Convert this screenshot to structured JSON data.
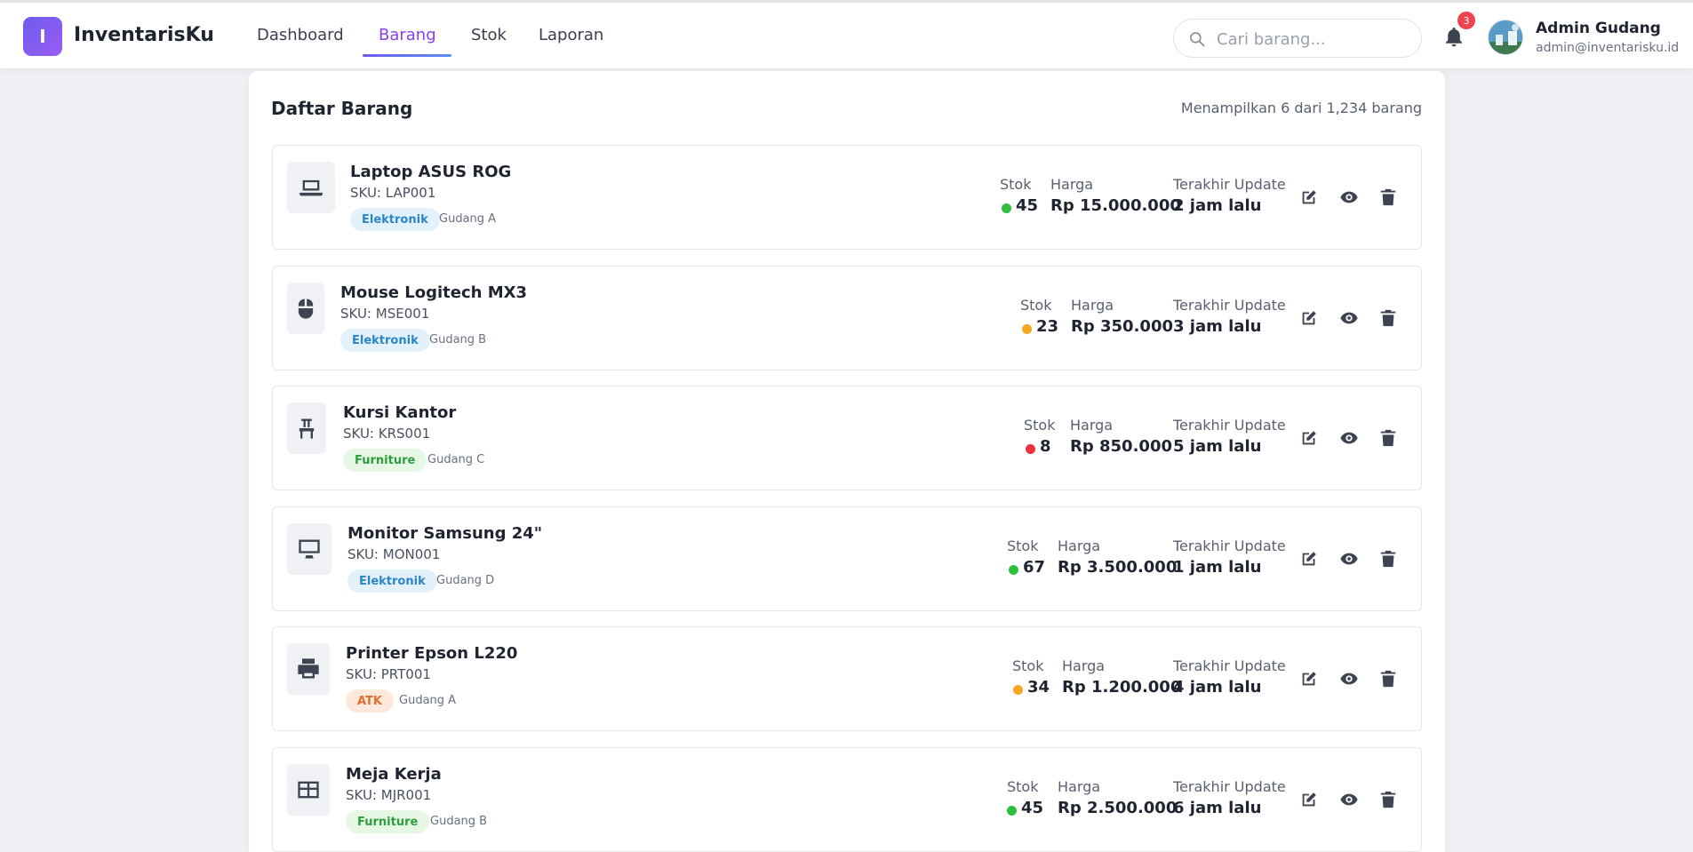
{
  "app": {
    "logo_letter": "I",
    "brand": "InventarisKu"
  },
  "nav": {
    "tabs": [
      {
        "label": "Dashboard"
      },
      {
        "label": "Barang",
        "active": true
      },
      {
        "label": "Stok"
      },
      {
        "label": "Laporan"
      }
    ]
  },
  "search": {
    "placeholder": "Cari barang..."
  },
  "notifications": {
    "count": "3"
  },
  "user": {
    "name": "Admin Gudang",
    "email": "admin@inventarisku.id"
  },
  "main": {
    "title": "Daftar Barang",
    "count_text": "Menampilkan 6 dari 1,234 barang",
    "labels": {
      "stock": "Stok",
      "price": "Harga",
      "updated": "Terakhir Update"
    },
    "items": [
      {
        "name": "Laptop ASUS ROG",
        "sku": "SKU: LAP001",
        "category": "Elektronik",
        "category_color": "blue",
        "warehouse": "Gudang A",
        "stock": "45",
        "stock_status": "green",
        "price": "Rp 15.000.000",
        "updated": "2 jam lalu",
        "icon": "laptop-icon"
      },
      {
        "name": "Mouse Logitech MX3",
        "sku": "SKU: MSE001",
        "category": "Elektronik",
        "category_color": "blue",
        "warehouse": "Gudang B",
        "stock": "23",
        "stock_status": "orange",
        "price": "Rp 350.000",
        "updated": "3 jam lalu",
        "icon": "mouse-icon"
      },
      {
        "name": "Kursi Kantor",
        "sku": "SKU: KRS001",
        "category": "Furniture",
        "category_color": "green",
        "warehouse": "Gudang C",
        "stock": "8",
        "stock_status": "red",
        "price": "Rp 850.000",
        "updated": "5 jam lalu",
        "icon": "chair-icon"
      },
      {
        "name": "Monitor Samsung 24\"",
        "sku": "SKU: MON001",
        "category": "Elektronik",
        "category_color": "blue",
        "warehouse": "Gudang D",
        "stock": "67",
        "stock_status": "green",
        "price": "Rp 3.500.000",
        "updated": "1 jam lalu",
        "icon": "monitor-icon"
      },
      {
        "name": "Printer Epson L220",
        "sku": "SKU: PRT001",
        "category": "ATK",
        "category_color": "orange",
        "warehouse": "Gudang A",
        "stock": "34",
        "stock_status": "orange",
        "price": "Rp 1.200.000",
        "updated": "4 jam lalu",
        "icon": "printer-icon"
      },
      {
        "name": "Meja Kerja",
        "sku": "SKU: MJR001",
        "category": "Furniture",
        "category_color": "green",
        "warehouse": "Gudang B",
        "stock": "45",
        "stock_status": "green",
        "price": "Rp 2.500.000",
        "updated": "6 jam lalu",
        "icon": "table-icon"
      }
    ]
  },
  "colors": {
    "accent": "#8a3ff0",
    "stock_green": "#2ec03d",
    "stock_orange": "#f5a623",
    "stock_red": "#ef2f3c"
  }
}
